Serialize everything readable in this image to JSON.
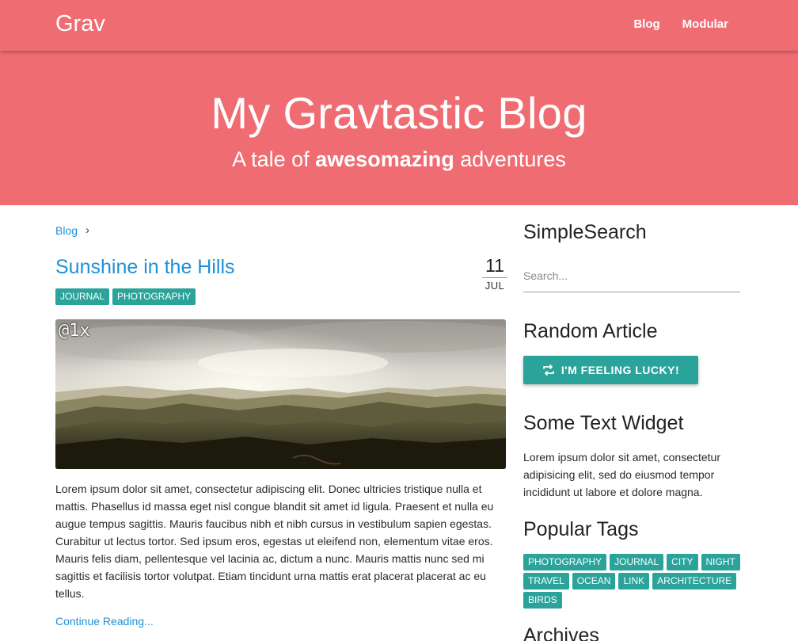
{
  "navbar": {
    "brand": "Grav",
    "links": [
      "Blog",
      "Modular"
    ]
  },
  "hero": {
    "title": "My Gravtastic Blog",
    "subtitle_prefix": "A tale of ",
    "subtitle_bold": "awesomazing",
    "subtitle_suffix": " adventures"
  },
  "breadcrumb": {
    "items": [
      "Blog"
    ],
    "separator": "›"
  },
  "post": {
    "title": "Sunshine in the Hills",
    "date_day": "11",
    "date_month": "JUL",
    "tags": [
      "JOURNAL",
      "PHOTOGRAPHY"
    ],
    "image_overlay": "@1x",
    "body": "Lorem ipsum dolor sit amet, consectetur adipiscing elit. Donec ultricies tristique nulla et mattis. Phasellus id massa eget nisl congue blandit sit amet id ligula. Praesent et nulla eu augue tempus sagittis. Mauris faucibus nibh et nibh cursus in vestibulum sapien egestas. Curabitur ut lectus tortor. Sed ipsum eros, egestas ut eleifend non, elementum vitae eros. Mauris felis diam, pellentesque vel lacinia ac, dictum a nunc. Mauris mattis nunc sed mi sagittis et facilisis tortor volutpat. Etiam tincidunt urna mattis erat placerat placerat ac eu tellus.",
    "read_more": "Continue Reading..."
  },
  "sidebar": {
    "search": {
      "heading": "SimpleSearch",
      "placeholder": "Search..."
    },
    "random": {
      "heading": "Random Article",
      "button_label": "I'M FEELING LUCKY!",
      "button_icon": "shuffle-icon"
    },
    "text_widget": {
      "heading": "Some Text Widget",
      "body": "Lorem ipsum dolor sit amet, consectetur adipisicing elit, sed do eiusmod tempor incididunt ut labore et dolore magna."
    },
    "popular_tags": {
      "heading": "Popular Tags",
      "tags": [
        "PHOTOGRAPHY",
        "JOURNAL",
        "CITY",
        "NIGHT",
        "TRAVEL",
        "OCEAN",
        "LINK",
        "ARCHITECTURE",
        "BIRDS"
      ]
    },
    "archives": {
      "heading": "Archives"
    }
  },
  "colors": {
    "brand": "#ef6c72",
    "accent": "#2aa39a",
    "link": "#1e90d6"
  }
}
